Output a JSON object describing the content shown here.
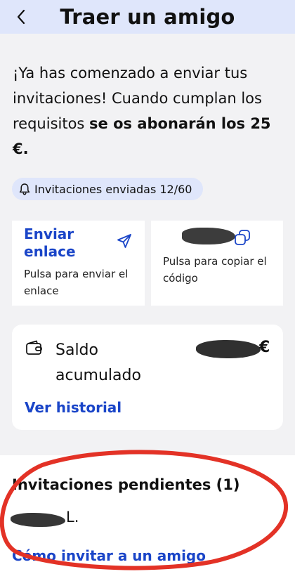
{
  "header": {
    "title": "Traer un amigo",
    "back_icon": "chevron-left-icon"
  },
  "intro": {
    "text_regular": "¡Ya has comenzado a enviar tus invitaciones! Cuando cumplan los requisitos ",
    "text_bold": "se os abonarán los 25 €."
  },
  "invites_chip": {
    "label": "Invitaciones enviadas 12/60",
    "icon": "bell-icon"
  },
  "send_card": {
    "title": "Enviar enlace",
    "description": "Pulsa para enviar el enlace",
    "icon": "send-icon"
  },
  "code_card": {
    "description": "Pulsa para copiar el código",
    "icon": "copy-icon"
  },
  "balance_card": {
    "label": "Saldo acumulado",
    "currency": "€",
    "history_link": "Ver historial",
    "icon": "wallet-icon"
  },
  "pending": {
    "title": "Invitaciones pendientes (1)",
    "name_suffix": "L.",
    "howto_link": "Cómo invitar a un amigo"
  },
  "colors": {
    "header_bg": "#dfe6fb",
    "link_blue": "#1a45c8",
    "annotation_red": "#e33226"
  }
}
